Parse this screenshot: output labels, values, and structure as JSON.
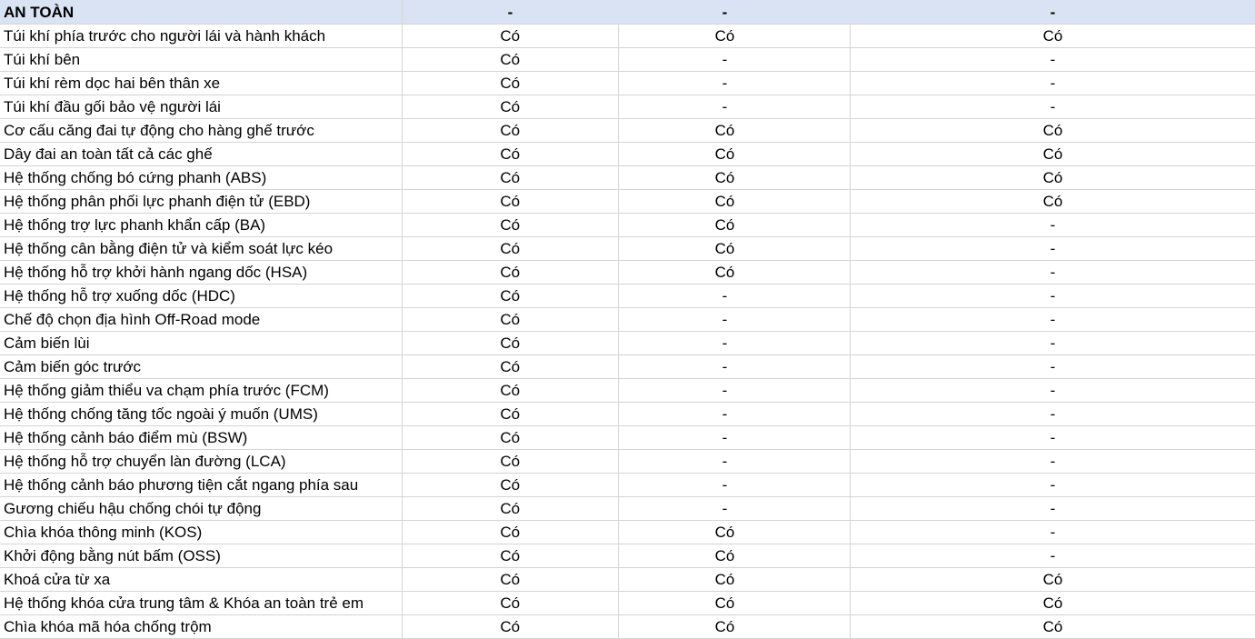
{
  "section": {
    "title": "AN TOÀN",
    "col1": "-",
    "col2": "-",
    "col3": "-"
  },
  "rows": [
    {
      "label": "Túi khí phía trước cho người lái và hành khách",
      "v1": "Có",
      "v2": "Có",
      "v3": "Có"
    },
    {
      "label": "Túi khí bên",
      "v1": "Có",
      "v2": "-",
      "v3": "-"
    },
    {
      "label": "Túi khí rèm dọc hai bên thân xe",
      "v1": "Có",
      "v2": "-",
      "v3": "-"
    },
    {
      "label": "Túi khí đầu gối bảo vệ người lái",
      "v1": "Có",
      "v2": "-",
      "v3": "-"
    },
    {
      "label": "Cơ cấu căng đai tự động cho hàng ghế trước",
      "v1": "Có",
      "v2": "Có",
      "v3": "Có"
    },
    {
      "label": "Dây đai an toàn tất cả các ghế",
      "v1": "Có",
      "v2": "Có",
      "v3": "Có"
    },
    {
      "label": "Hệ thống chống bó cứng phanh (ABS)",
      "v1": "Có",
      "v2": "Có",
      "v3": "Có"
    },
    {
      "label": "Hệ thống phân phối lực phanh điện tử (EBD)",
      "v1": "Có",
      "v2": "Có",
      "v3": "Có"
    },
    {
      "label": "Hệ thống trợ lực phanh khẩn cấp (BA)",
      "v1": "Có",
      "v2": "Có",
      "v3": "-"
    },
    {
      "label": "Hệ thống cân bằng điện tử và kiểm soát lực kéo",
      "v1": "Có",
      "v2": "Có",
      "v3": "-"
    },
    {
      "label": "Hệ thống hỗ trợ khởi hành ngang dốc (HSA)",
      "v1": "Có",
      "v2": "Có",
      "v3": "-"
    },
    {
      "label": "Hệ thống hỗ trợ xuống dốc (HDC)",
      "v1": "Có",
      "v2": "-",
      "v3": "-"
    },
    {
      "label": "Chế độ chọn địa hình Off-Road mode",
      "v1": "Có",
      "v2": "-",
      "v3": "-"
    },
    {
      "label": "Cảm biến lùi",
      "v1": "Có",
      "v2": "-",
      "v3": "-"
    },
    {
      "label": "Cảm biến góc trước",
      "v1": "Có",
      "v2": "-",
      "v3": "-"
    },
    {
      "label": "Hệ thống giảm thiểu va chạm phía trước (FCM)",
      "v1": "Có",
      "v2": "-",
      "v3": "-"
    },
    {
      "label": "Hệ thống chống tăng tốc ngoài ý muốn (UMS)",
      "v1": "Có",
      "v2": "-",
      "v3": "-"
    },
    {
      "label": "Hệ thống cảnh báo điểm mù (BSW)",
      "v1": "Có",
      "v2": "-",
      "v3": "-"
    },
    {
      "label": "Hệ thống hỗ trợ chuyển làn đường (LCA)",
      "v1": "Có",
      "v2": "-",
      "v3": "-"
    },
    {
      "label": "Hệ thống cảnh báo phương tiện cắt ngang phía sau",
      "v1": "Có",
      "v2": "-",
      "v3": "-"
    },
    {
      "label": "Gương chiếu hậu chống chói tự động",
      "v1": "Có",
      "v2": "-",
      "v3": "-"
    },
    {
      "label": "Chìa khóa thông minh (KOS)",
      "v1": "Có",
      "v2": "Có",
      "v3": "-"
    },
    {
      "label": "Khởi động bằng nút bấm (OSS)",
      "v1": "Có",
      "v2": "Có",
      "v3": "-"
    },
    {
      "label": "Khoá cửa từ xa",
      "v1": "Có",
      "v2": "Có",
      "v3": "Có"
    },
    {
      "label": "Hệ thống khóa cửa trung tâm & Khóa an toàn trẻ em",
      "v1": "Có",
      "v2": "Có",
      "v3": "Có"
    },
    {
      "label": "Chìa khóa mã hóa chống trộm",
      "v1": "Có",
      "v2": "Có",
      "v3": "Có"
    }
  ]
}
